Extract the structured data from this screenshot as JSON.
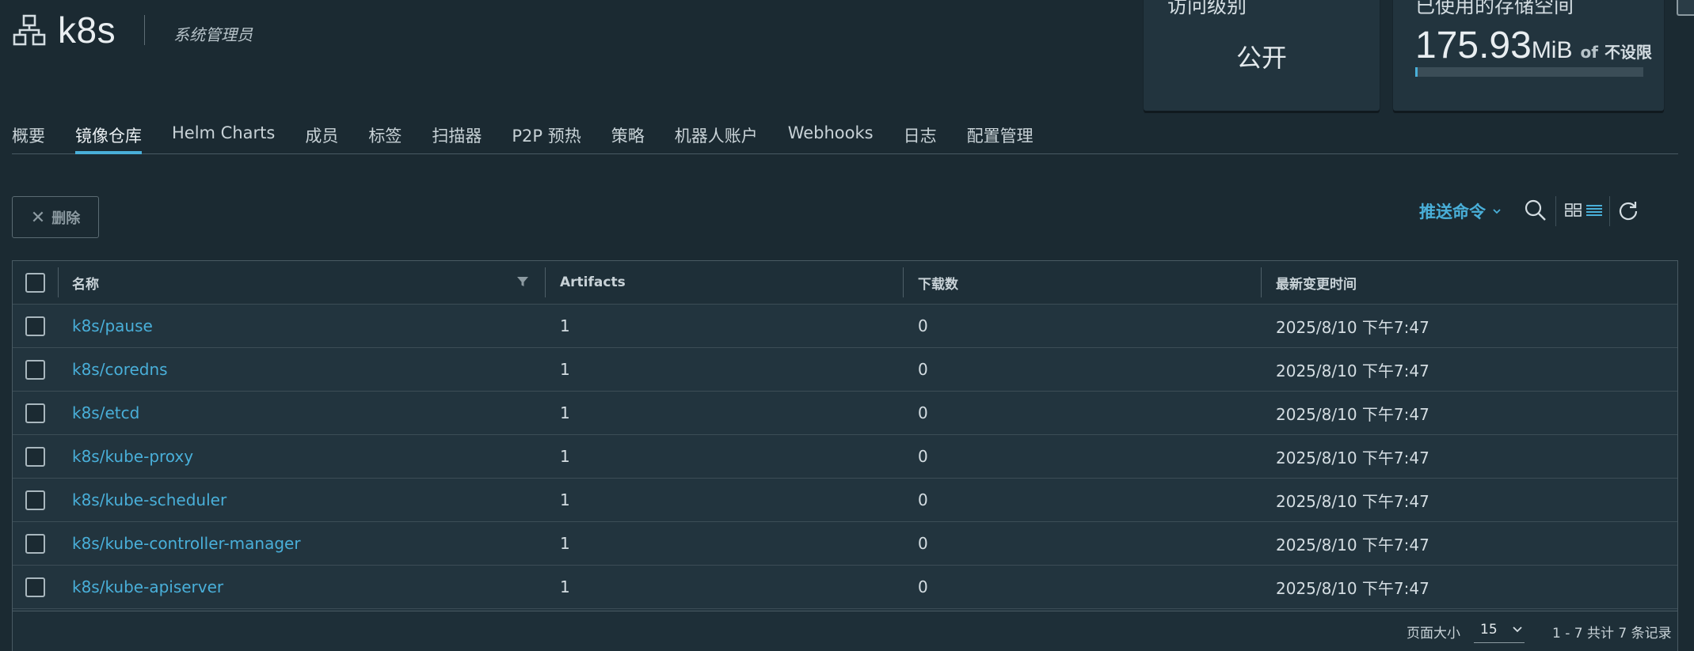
{
  "project": {
    "name": "k8s",
    "role": "系统管理员"
  },
  "cards": {
    "access_title": "访问级别",
    "access_value": "公开",
    "storage_title": "已使用的存储空间",
    "storage_value": "175.93",
    "storage_unit": "MiB",
    "storage_of": "of",
    "storage_limit": "不设限",
    "storage_used_fraction": 0.01
  },
  "tabs": [
    {
      "label": "概要"
    },
    {
      "label": "镜像仓库",
      "active": true
    },
    {
      "label": "Helm Charts"
    },
    {
      "label": "成员"
    },
    {
      "label": "标签"
    },
    {
      "label": "扫描器"
    },
    {
      "label": "P2P 预热"
    },
    {
      "label": "策略"
    },
    {
      "label": "机器人账户"
    },
    {
      "label": "Webhooks"
    },
    {
      "label": "日志"
    },
    {
      "label": "配置管理"
    }
  ],
  "toolbar": {
    "delete_label": "删除",
    "push_command_label": "推送命令"
  },
  "table": {
    "headers": {
      "name": "名称",
      "artifacts": "Artifacts",
      "downloads": "下载数",
      "updated": "最新变更时间"
    },
    "rows": [
      {
        "name": "k8s/pause",
        "artifacts": "1",
        "downloads": "0",
        "updated": "2025/8/10 下午7:47"
      },
      {
        "name": "k8s/coredns",
        "artifacts": "1",
        "downloads": "0",
        "updated": "2025/8/10 下午7:47"
      },
      {
        "name": "k8s/etcd",
        "artifacts": "1",
        "downloads": "0",
        "updated": "2025/8/10 下午7:47"
      },
      {
        "name": "k8s/kube-proxy",
        "artifacts": "1",
        "downloads": "0",
        "updated": "2025/8/10 下午7:47"
      },
      {
        "name": "k8s/kube-scheduler",
        "artifacts": "1",
        "downloads": "0",
        "updated": "2025/8/10 下午7:47"
      },
      {
        "name": "k8s/kube-controller-manager",
        "artifacts": "1",
        "downloads": "0",
        "updated": "2025/8/10 下午7:47"
      },
      {
        "name": "k8s/kube-apiserver",
        "artifacts": "1",
        "downloads": "0",
        "updated": "2025/8/10 下午7:47"
      }
    ]
  },
  "pagination": {
    "page_size_label": "页面大小",
    "page_size": "15",
    "summary": "1 - 7 共计 7 条记录"
  },
  "colors": {
    "background": "#1b2a32",
    "accent": "#49afd9",
    "card": "#22343e"
  },
  "icons": [
    "project-icon",
    "close-icon",
    "chevron-down-icon",
    "search-icon",
    "card-view-icon",
    "list-view-icon",
    "refresh-icon",
    "filter-icon"
  ]
}
